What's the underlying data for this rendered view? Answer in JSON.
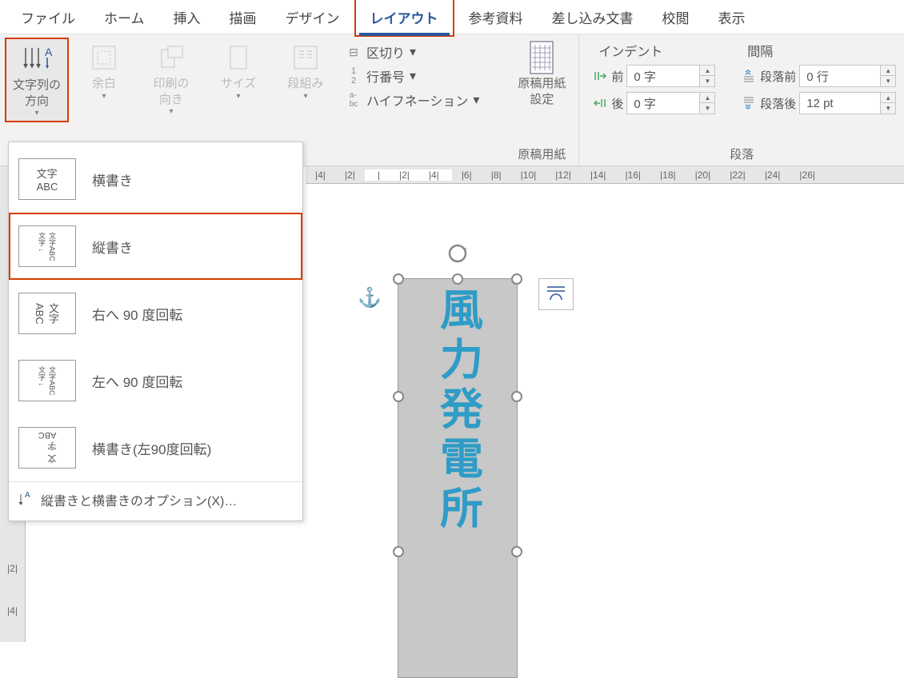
{
  "tabs": {
    "file": "ファイル",
    "home": "ホーム",
    "insert": "挿入",
    "draw": "描画",
    "design": "デザイン",
    "layout": "レイアウト",
    "references": "参考資料",
    "mailings": "差し込み文書",
    "review": "校閲",
    "view": "表示"
  },
  "pageSetup": {
    "textDirection": "文字列の\n方向",
    "margins": "余白",
    "orientation": "印刷の\n向き",
    "size": "サイズ",
    "columns": "段組み",
    "breaks": "区切り",
    "lineNumbers": "行番号",
    "hyphenation": "ハイフネーション"
  },
  "manuscript": {
    "button": "原稿用紙\n設定",
    "groupLabel": "原稿用紙"
  },
  "paragraph": {
    "indentLabel": "インデント",
    "spacingLabel": "間隔",
    "before": "前",
    "after": "後",
    "paraBefore": "段落前",
    "paraAfter": "段落後",
    "indentBeforeVal": "0 字",
    "indentAfterVal": "0 字",
    "spaceBeforeVal": "0 行",
    "spaceAfterVal": "12 pt",
    "groupLabel": "段落"
  },
  "textDirectionMenu": {
    "horizontal": "横書き",
    "vertical": "縦書き",
    "rotate90right": "右へ 90 度回転",
    "rotate90left": "左へ 90 度回転",
    "horizontalRotated": "横書き(左90度回転)",
    "options": "縦書きと横書きのオプション(X)…",
    "icon_h": "文字\nABC",
    "icon_v": "文字ABC\n文字 ↓",
    "icon_r90r": "文字\nABC",
    "icon_r90l": "文字ABC\n文字 ↓",
    "icon_hrot": "文\n字\nABC"
  },
  "ruler": {
    "marks": [
      "|4|",
      "|2|",
      "|",
      "|2|",
      "|4|",
      "|6|",
      "|8|",
      "|10|",
      "|12|",
      "|14|",
      "|16|",
      "|18|",
      "|20|",
      "|22|",
      "|24|",
      "|26|"
    ],
    "vmarks": "|2|\n\n|4|"
  },
  "document": {
    "textboxContent": "風力発電所"
  }
}
